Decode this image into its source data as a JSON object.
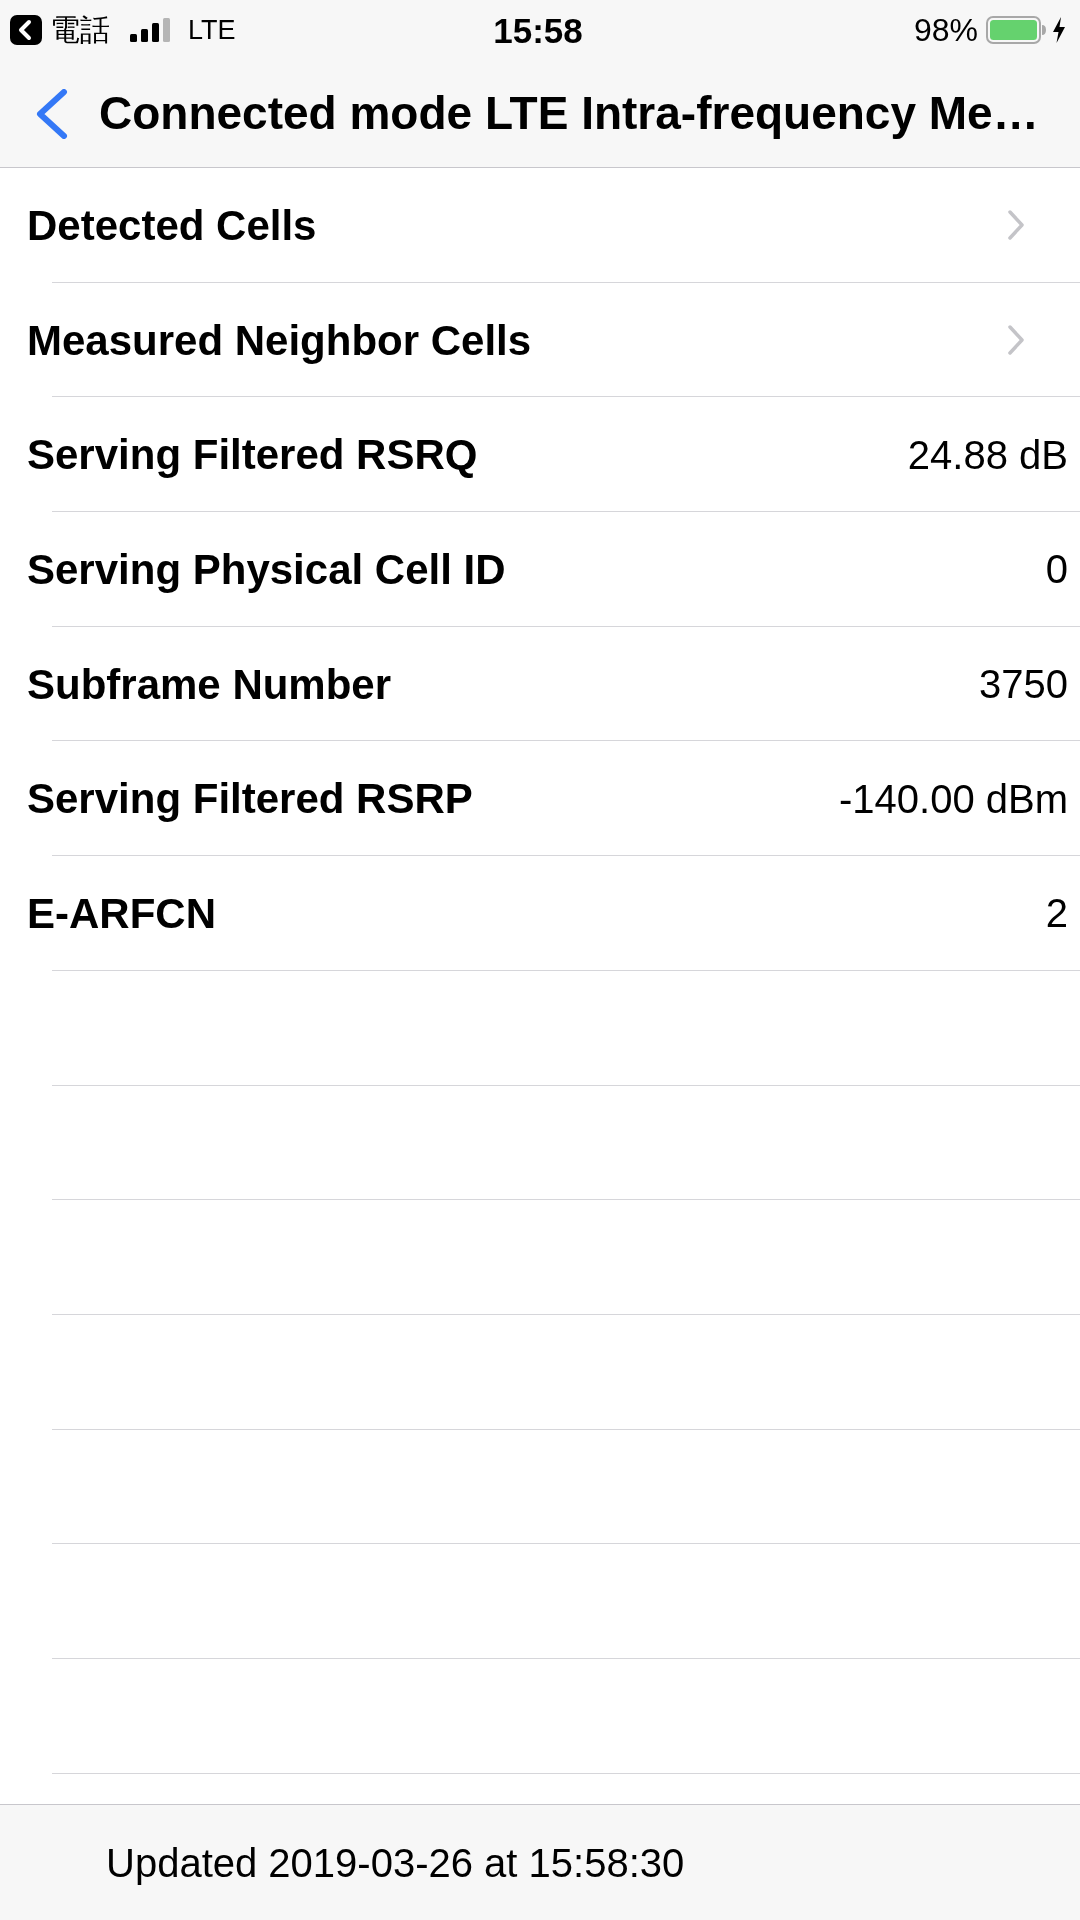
{
  "status_bar": {
    "back_label": "電話",
    "network": "LTE",
    "time": "15:58",
    "battery": "98%",
    "charging": true
  },
  "nav_bar": {
    "title": "Connected mode LTE Intra-frequency Me…"
  },
  "rows": [
    {
      "kind": "link",
      "label": "Detected Cells"
    },
    {
      "kind": "link",
      "label": "Measured Neighbor Cells"
    },
    {
      "kind": "value",
      "label": "Serving Filtered RSRQ",
      "value": "24.88 dB"
    },
    {
      "kind": "value",
      "label": "Serving Physical Cell ID",
      "value": "0"
    },
    {
      "kind": "value",
      "label": "Subframe Number",
      "value": "3750"
    },
    {
      "kind": "value",
      "label": "Serving Filtered RSRP",
      "value": "-140.00 dBm"
    },
    {
      "kind": "value",
      "label": "E-ARFCN",
      "value": "2"
    }
  ],
  "footer": {
    "text": "Updated 2019-03-26 at 15:58:30"
  }
}
